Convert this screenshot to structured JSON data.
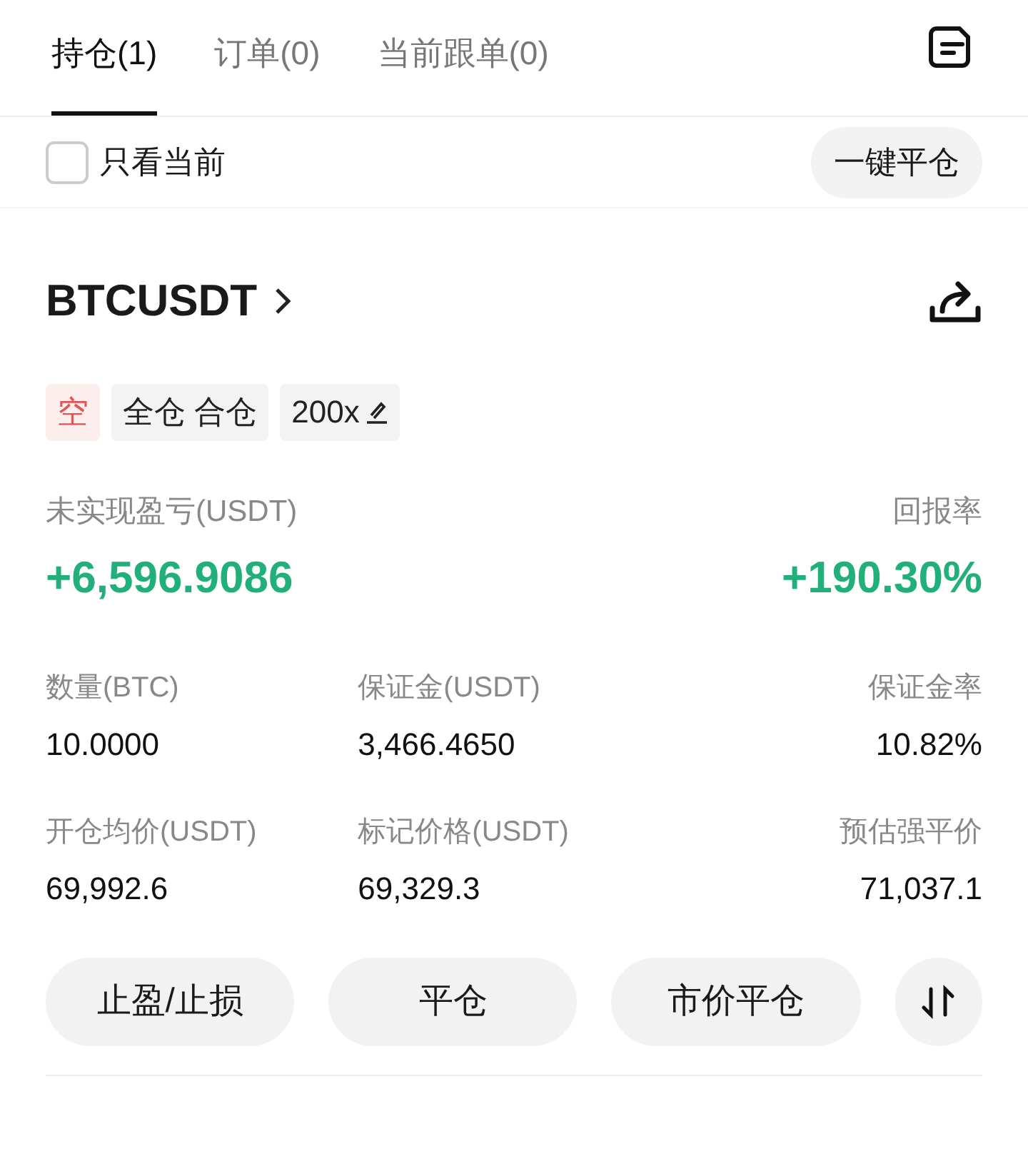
{
  "tabs": [
    {
      "label": "持仓(1)",
      "selected": true
    },
    {
      "label": "订单(0)",
      "selected": false
    },
    {
      "label": "当前跟单(0)",
      "selected": false
    }
  ],
  "filter": {
    "label": "只看当前",
    "checked": false
  },
  "close_all_button": "一键平仓",
  "position": {
    "symbol": "BTCUSDT",
    "tags": [
      {
        "label": "空",
        "kind": "side"
      },
      {
        "label": "全仓 合仓",
        "kind": "mode"
      },
      {
        "label": "200x",
        "kind": "leverage"
      }
    ],
    "pnl_label": "未实现盈亏(USDT)",
    "pnl_value": "+6,596.9086",
    "roe_label": "回报率",
    "roe_value": "+190.30%",
    "stats": [
      {
        "label": "数量(BTC)",
        "value": "10.0000"
      },
      {
        "label": "保证金(USDT)",
        "value": "3,466.4650"
      },
      {
        "label": "保证金率",
        "value": "10.82%"
      },
      {
        "label": "开仓均价(USDT)",
        "value": "69,992.6"
      },
      {
        "label": "标记价格(USDT)",
        "value": "69,329.3"
      },
      {
        "label": "预估强平价",
        "value": "71,037.1"
      }
    ],
    "actions": [
      "止盈/止损",
      "平仓",
      "市价平仓"
    ]
  }
}
